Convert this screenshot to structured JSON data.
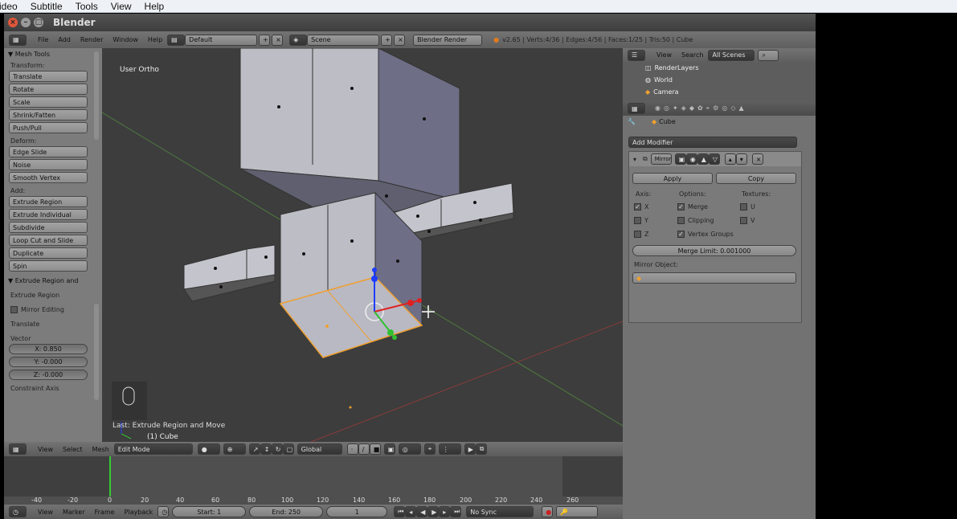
{
  "player_menu": [
    "ideo",
    "Subtitle",
    "Tools",
    "View",
    "Help"
  ],
  "titlebar": {
    "title": "Blender"
  },
  "info_header": {
    "menus": [
      "File",
      "Add",
      "Render",
      "Window",
      "Help"
    ],
    "layout": "Default",
    "scene": "Scene",
    "engine": "Blender Render",
    "stats": "v2.65 | Verts:4/36 | Edges:4/56 | Faces:1/25 | Tris:50 | Cube"
  },
  "tools": {
    "panel_title": "Mesh Tools",
    "transform_label": "Transform:",
    "transform_buttons": [
      "Translate",
      "Rotate",
      "Scale",
      "Shrink/Fatten",
      "Push/Pull"
    ],
    "deform_label": "Deform:",
    "deform_buttons": [
      "Edge Slide",
      "Noise",
      "Smooth Vertex"
    ],
    "add_label": "Add:",
    "add_buttons": [
      "Extrude Region",
      "Extrude Individual",
      "Subdivide",
      "Loop Cut and Slide",
      "Duplicate",
      "Spin"
    ],
    "op_panel_title": "Extrude Region and",
    "op_name": "Extrude Region",
    "mirror_editing": "Mirror Editing",
    "translate_label": "Translate",
    "vector_label": "Vector",
    "x": "X: 0.850",
    "y": "Y: -0.000",
    "z": "Z: -0.000",
    "constraint_axis": "Constraint Axis"
  },
  "viewport": {
    "view_label": "User Ortho",
    "last_op": "Last: Extrude Region and Move",
    "object_label": "(1) Cube"
  },
  "viewport_header": {
    "menus": [
      "View",
      "Select",
      "Mesh"
    ],
    "mode": "Edit Mode",
    "orientation": "Global"
  },
  "timeline": {
    "ticks": [
      "-40",
      "-20",
      "0",
      "20",
      "40",
      "60",
      "80",
      "100",
      "120",
      "140",
      "160",
      "180",
      "200",
      "220",
      "240",
      "260"
    ]
  },
  "timeline_header": {
    "menus": [
      "View",
      "Marker",
      "Frame",
      "Playback"
    ],
    "start": "Start: 1",
    "end": "End: 250",
    "frame": "1",
    "sync": "No Sync"
  },
  "outliner": {
    "menus": [
      "View",
      "Search"
    ],
    "filter": "All Scenes",
    "items": [
      "RenderLayers",
      "World",
      "Camera"
    ]
  },
  "properties": {
    "object": "Cube",
    "add_modifier": "Add Modifier",
    "modifier_name": "Mirror",
    "apply": "Apply",
    "copy": "Copy",
    "axis_label": "Axis:",
    "options_label": "Options:",
    "textures_label": "Textures:",
    "axes": [
      "X",
      "Y",
      "Z"
    ],
    "options": [
      "Merge",
      "Clipping",
      "Vertex Groups"
    ],
    "textures": [
      "U",
      "V"
    ],
    "merge_limit": "Merge Limit: 0.001000",
    "mirror_object": "Mirror Object:"
  },
  "colors": {
    "viewport_bg": "#3d3d3d",
    "panel_bg": "#727272",
    "selection": "#f5a623",
    "face": "#bdbdc5"
  }
}
